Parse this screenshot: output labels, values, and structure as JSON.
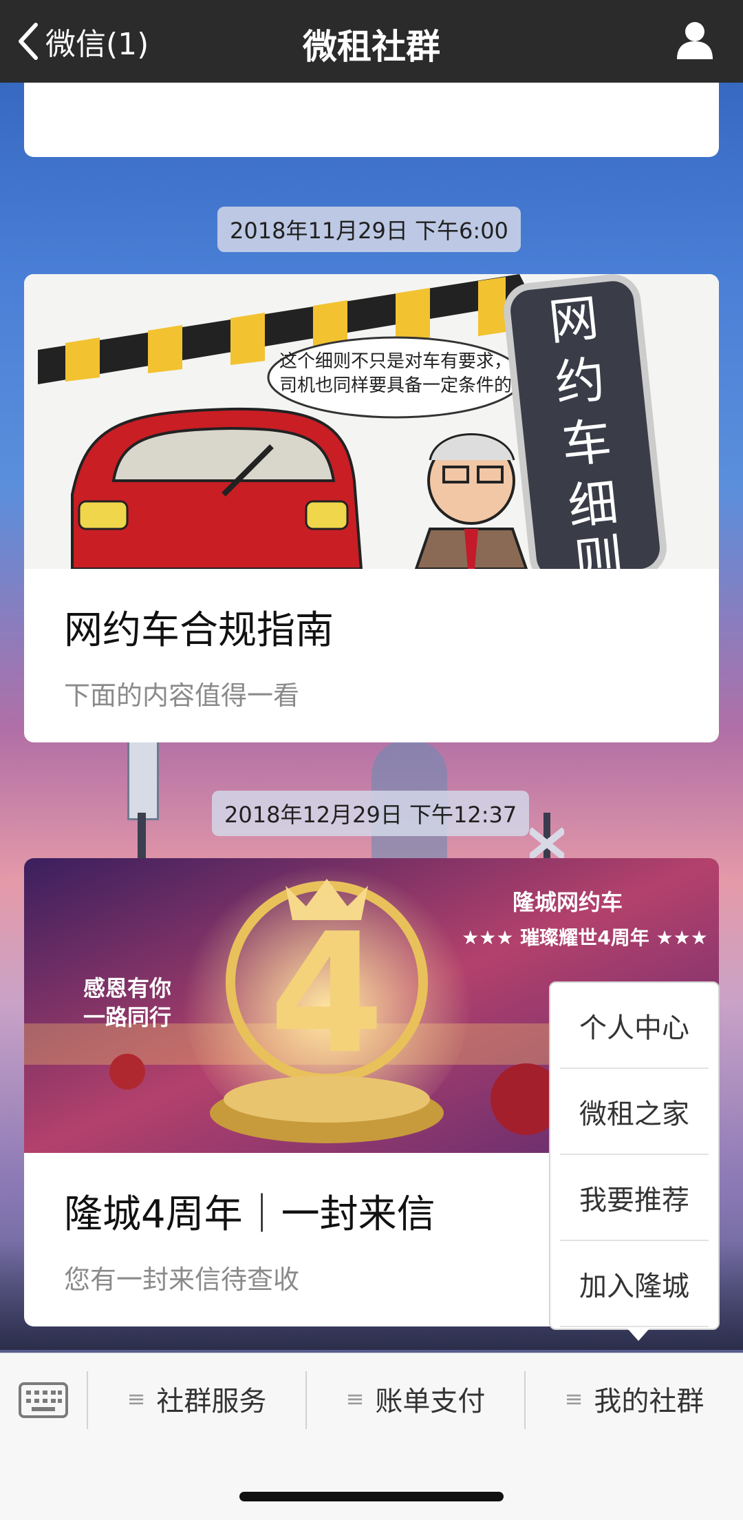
{
  "header": {
    "back_label": "微信(1)",
    "title": "微租社群"
  },
  "messages": [
    {
      "time": "2018年11月29日 下午6:00",
      "title": "网约车合规指南",
      "subtitle": "下面的内容值得一看",
      "image_text": {
        "speech": "这个细则不只是对车有要求，司机也同样要具备一定条件的",
        "sign": "网约车细则"
      }
    },
    {
      "time": "2018年12月29日 下午12:37",
      "title": "隆城4周年｜一封来信",
      "subtitle": "您有一封来信待查收",
      "image_text": {
        "left": "感恩有你 一路同行",
        "right_1": "隆城网约车",
        "right_2": "★★★ 璀璨耀世4周年 ★★★",
        "number": "4"
      }
    }
  ],
  "bottom_menu": {
    "items": [
      "社群服务",
      "账单支付",
      "我的社群"
    ]
  },
  "popup_menu": {
    "items": [
      "个人中心",
      "微租之家",
      "我要推荐",
      "加入隆城"
    ]
  },
  "icons": {
    "back": "chevron-left-icon",
    "profile": "person-icon",
    "keyboard": "keyboard-icon",
    "menu": "hamburger-lines-icon"
  },
  "colors": {
    "header_bg": "#2b2b2b",
    "card_bg": "#ffffff",
    "popup_bg": "#ffffff"
  }
}
